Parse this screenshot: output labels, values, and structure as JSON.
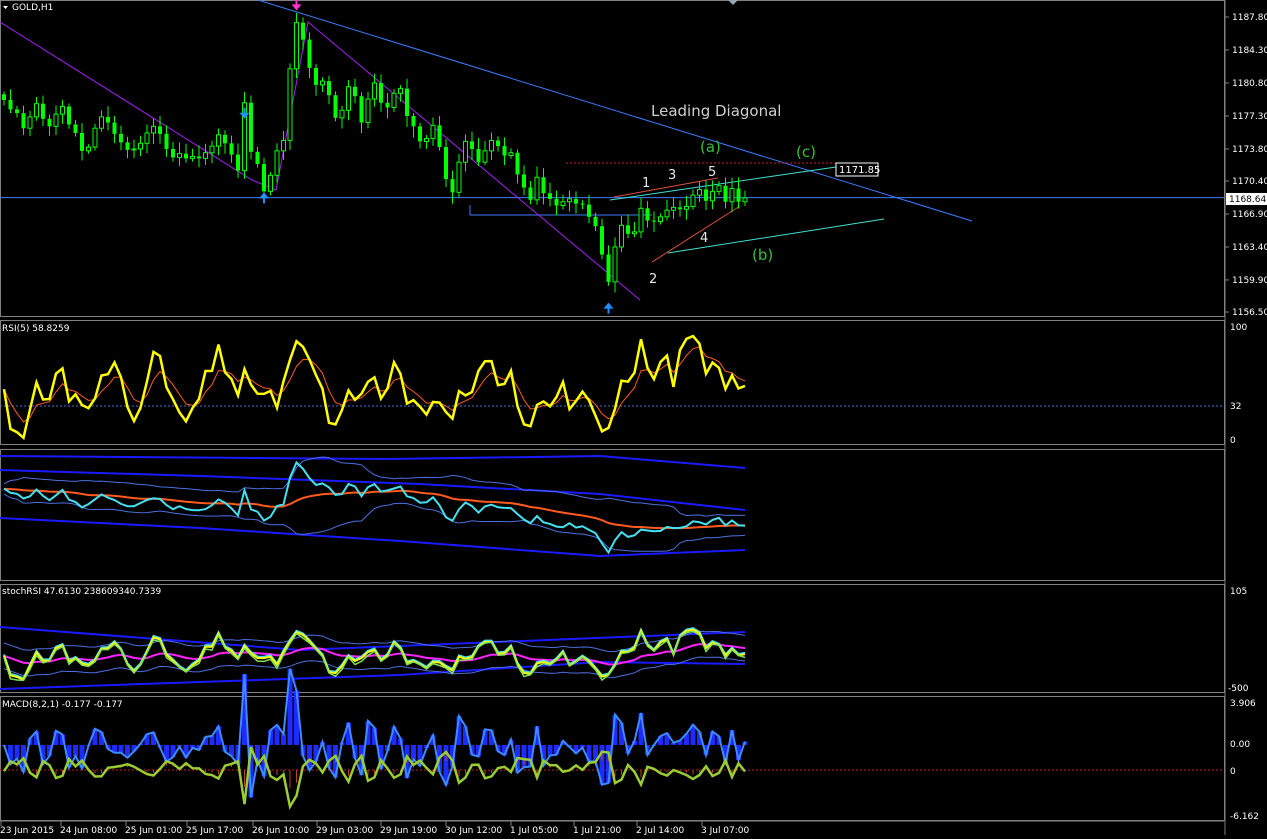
{
  "chart_data": [
    {
      "type": "candlestick",
      "title": "GOLD,H1",
      "ylim": [
        1156.5,
        1189.5
      ],
      "y_ticks": [
        "1187.80",
        "1184.30",
        "1180.80",
        "1177.30",
        "1173.80",
        "1170.40",
        "1166.90",
        "1163.40",
        "1159.90",
        "1156.50"
      ],
      "current_price": "1168.64",
      "price_tag": "1171.85",
      "annotations": [
        "Leading Diagonal",
        "(a)",
        "(b)",
        "(c)",
        "1",
        "2",
        "3",
        "4",
        "5"
      ],
      "closes": [
        1179,
        1178,
        1177.6,
        1176,
        1177.2,
        1178.6,
        1177,
        1176.2,
        1177.5,
        1178.3,
        1176.4,
        1175.5,
        1173.6,
        1174,
        1176,
        1177.2,
        1176.6,
        1175.4,
        1174.5,
        1173.7,
        1173.8,
        1174.4,
        1175.5,
        1176.2,
        1175.4,
        1173.8,
        1172.9,
        1173.3,
        1172.8,
        1173,
        1172.8,
        1173.4,
        1174.1,
        1175.3,
        1174.4,
        1173.2,
        1171.5,
        1178.7,
        1173.5,
        1172.2,
        1169.3,
        1171,
        1173.6,
        1174.7,
        1182.3,
        1187.2,
        1185.4,
        1182.4,
        1180.6,
        1181,
        1179.5,
        1177.1,
        1177.9,
        1180.4,
        1179.4,
        1176.6,
        1179.1,
        1180.8,
        1178.7,
        1178.2,
        1179.7,
        1180.2,
        1177.3,
        1176.2,
        1174.6,
        1174.9,
        1176.3,
        1174,
        1170.6,
        1169.2,
        1172.4,
        1174.6,
        1173.8,
        1172.4,
        1173.6,
        1174.7,
        1174.1,
        1173.1,
        1173.4,
        1171.1,
        1169.7,
        1168.4,
        1170.8,
        1169.1,
        1168.5,
        1167.8,
        1168.2,
        1168.5,
        1168,
        1167.9,
        1166.6,
        1165.6,
        1162.6,
        1159.7,
        1163.4,
        1165.7,
        1164.8,
        1165,
        1167.5,
        1166.2,
        1166.1,
        1166.6,
        1167.3,
        1167.6,
        1167.4,
        1167.7,
        1168.9,
        1169.5,
        1168.3,
        1169.3,
        1169.9,
        1168.2,
        1169.6,
        1168.2,
        1168.6
      ],
      "pivots": [
        {
          "i": 37,
          "price": 1176.9,
          "dir": "down"
        },
        {
          "i": 40,
          "price": 1169.3,
          "dir": "up"
        },
        {
          "i": 45,
          "price": 1188.4,
          "dir": "down"
        },
        {
          "i": 93,
          "price": 1157.6,
          "dir": "up"
        }
      ]
    },
    {
      "type": "line",
      "title": "RSI(5) 58.8259",
      "ylim": [
        0,
        100
      ],
      "y_ticks": [
        "100",
        "32",
        "0"
      ],
      "level": 32,
      "series": [
        {
          "name": "RSI(5)",
          "last": 58.8259
        }
      ]
    },
    {
      "type": "line",
      "title": "",
      "series": [
        {
          "name": "bands"
        }
      ]
    },
    {
      "type": "line",
      "title": "stochRSI 47.6130 238609340.7339",
      "y_ticks": [
        "105",
        "-500"
      ],
      "series": [
        {
          "name": "stochRSI",
          "last": 47.613
        }
      ]
    },
    {
      "type": "bar",
      "title": "MACD(8,2,1) -0.177 -0.177",
      "ylim": [
        -6.162,
        3.906
      ],
      "y_ticks": [
        "3.906",
        "0.00",
        "0",
        "-6.162"
      ],
      "series": [
        {
          "name": "MACD(8,2,1)",
          "last": -0.177
        }
      ]
    }
  ],
  "x_axis": {
    "labels": [
      "23 Jun 2015",
      "24 Jun 08:00",
      "25 Jun 01:00",
      "25 Jun 17:00",
      "26 Jun 10:00",
      "29 Jun 03:00",
      "29 Jun 19:00",
      "30 Jun 12:00",
      "1 Jul 05:00",
      "1 Jul 21:00",
      "2 Jul 14:00",
      "3 Jul 07:00"
    ]
  },
  "colors": {
    "background": "#000000",
    "bull": "#00ff00",
    "trend": "#3e7bff",
    "rsi": "#ffff00",
    "signal": "#ff5a1f",
    "cyan": "#45e0f0",
    "band": "#1a1aff",
    "macd_hist": "#1e2bff",
    "macd_line": "#3d8cff",
    "macd_signal": "#9acd32",
    "label_green": "#38c038"
  }
}
